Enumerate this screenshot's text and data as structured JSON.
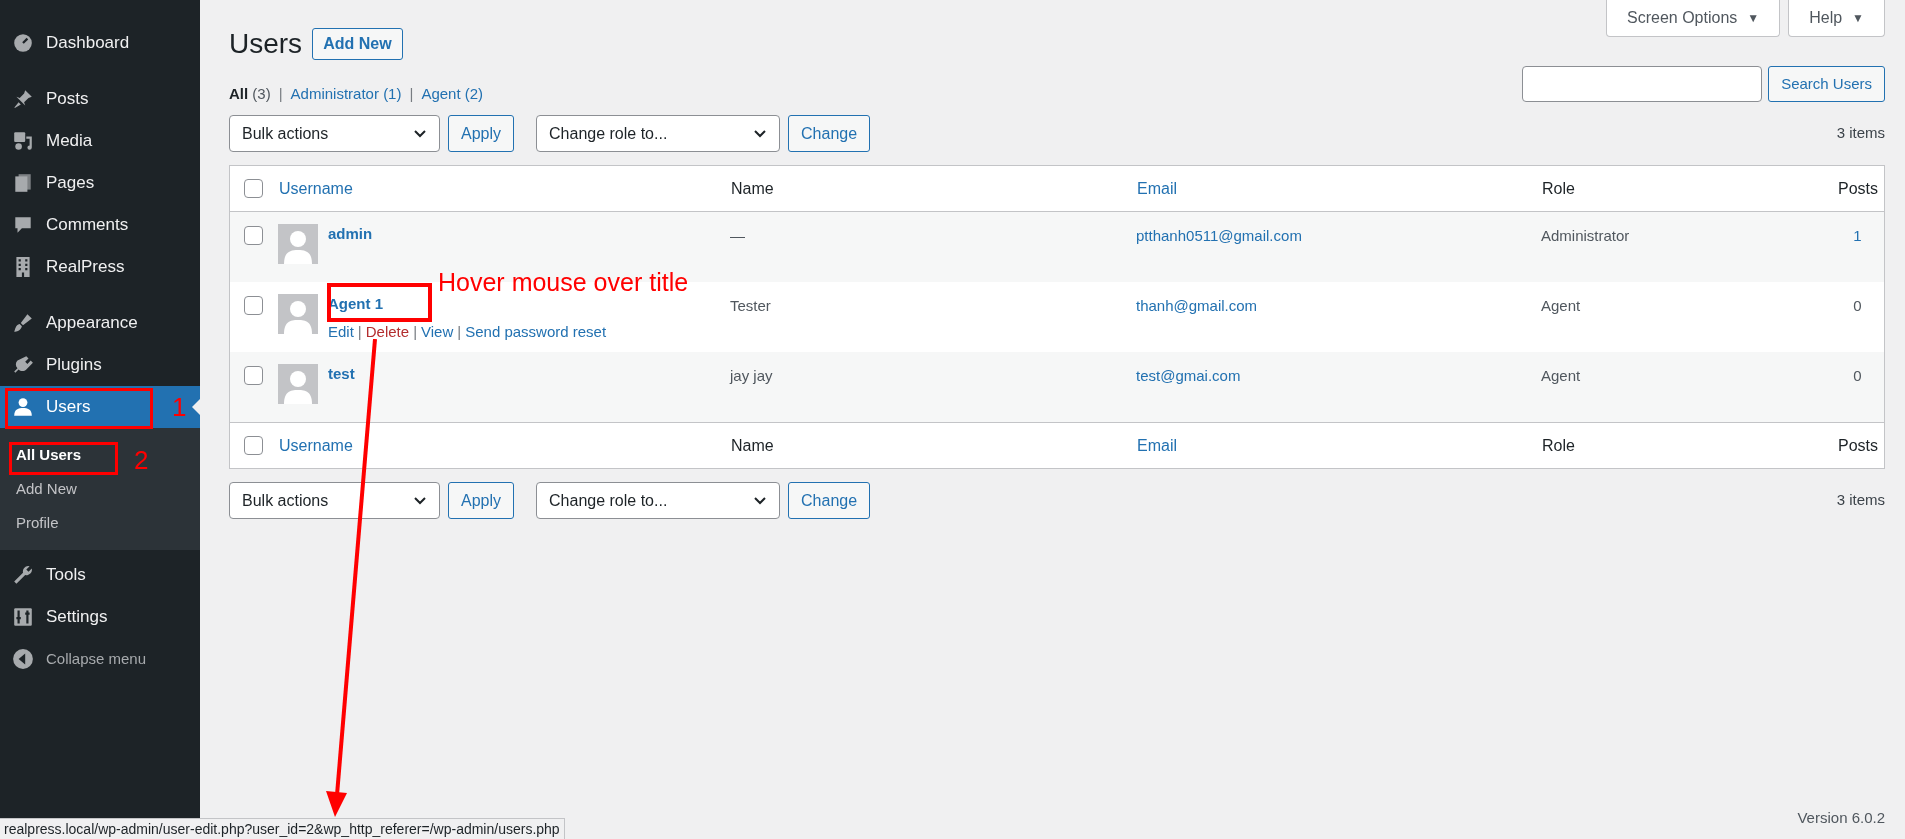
{
  "sidebar": {
    "items": [
      {
        "label": "Dashboard",
        "selected": false
      },
      {
        "label": "Posts",
        "selected": false
      },
      {
        "label": "Media",
        "selected": false
      },
      {
        "label": "Pages",
        "selected": false
      },
      {
        "label": "Comments",
        "selected": false
      },
      {
        "label": "RealPress",
        "selected": false
      },
      {
        "label": "Appearance",
        "selected": false
      },
      {
        "label": "Plugins",
        "selected": false
      },
      {
        "label": "Users",
        "selected": true,
        "children": [
          {
            "label": "All Users",
            "selected": true
          },
          {
            "label": "Add New",
            "selected": false
          },
          {
            "label": "Profile",
            "selected": false
          }
        ]
      },
      {
        "label": "Tools",
        "selected": false
      },
      {
        "label": "Settings",
        "selected": false
      }
    ],
    "collapse": "Collapse menu"
  },
  "top_buttons": [
    {
      "label": "Screen Options",
      "caret": "▼"
    },
    {
      "label": "Help",
      "caret": "▼"
    }
  ],
  "page_title": "Users",
  "add_new": "Add New",
  "filters": [
    {
      "label": "All",
      "count": "(3)",
      "selected": true
    },
    {
      "separator": "|",
      "label": "Administrator",
      "count": "(1)",
      "selected": false
    },
    {
      "separator": "|",
      "label": "Agent",
      "count": "(2)",
      "selected": false
    }
  ],
  "search": {
    "button": "Search Users"
  },
  "toolbars": [
    {
      "bulk": "Bulk actions",
      "apply": "Apply",
      "role": "Change role to...",
      "change": "Change",
      "count": "3 items"
    },
    {
      "bulk": "Bulk actions",
      "apply": "Apply",
      "role": "Change role to...",
      "change": "Change",
      "count": "3 items"
    }
  ],
  "table": {
    "select_all_checked": false,
    "columns": [
      "Username",
      "Name",
      "Email",
      "Role",
      "Posts"
    ],
    "rows": [
      {
        "username": "admin",
        "name": "—",
        "email": "ptthanh0511@gmail.com",
        "role": "Administrator",
        "posts": "1",
        "posts_link": true,
        "checked": false,
        "actions": []
      },
      {
        "username": "Agent 1",
        "name": "Tester",
        "email": "thanh@gmail.com",
        "role": "Agent",
        "posts": "0",
        "posts_link": false,
        "checked": false,
        "actions": [
          {
            "label": "Edit",
            "kind": "normal"
          },
          {
            "separator": "|",
            "label": "Delete",
            "kind": "danger"
          },
          {
            "separator": "|",
            "label": "View",
            "kind": "normal"
          },
          {
            "separator": "|",
            "label": "Send password reset",
            "kind": "normal"
          }
        ]
      },
      {
        "username": "test",
        "name": "jay jay",
        "email": "test@gmai.com",
        "role": "Agent",
        "posts": "0",
        "posts_link": false,
        "checked": false,
        "actions": []
      }
    ],
    "footer_select_all_checked": false,
    "footer_columns": [
      "Username",
      "Name",
      "Email",
      "Role",
      "Posts"
    ]
  },
  "footer": {
    "version": "Version 6.0.2"
  },
  "status_bar": "realpress.local/wp-admin/user-edit.php?user_id=2&wp_http_referer=/wp-admin/users.php",
  "annotations": {
    "step_1": "1",
    "step_2": "2",
    "note": "Hover mouse over title"
  }
}
